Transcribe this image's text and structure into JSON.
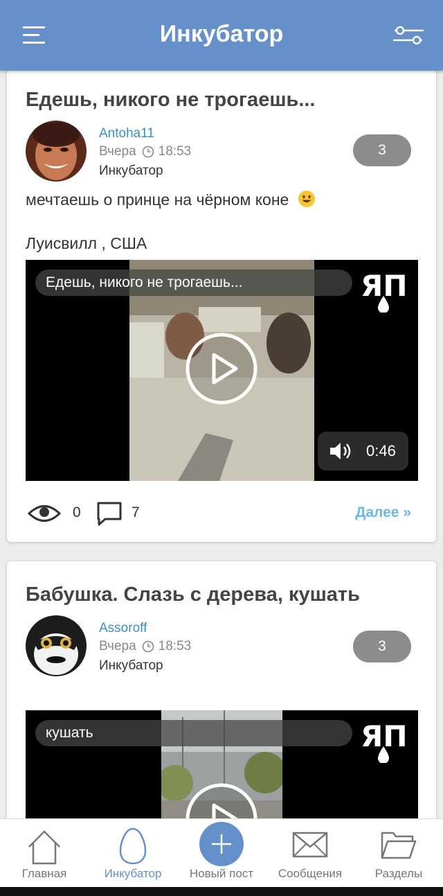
{
  "header": {
    "title": "Инкубатор",
    "menu_icon": "hamburger-menu-icon",
    "filter_icon": "sliders-filter-icon"
  },
  "posts": [
    {
      "title": "Едешь, никого не трогаешь...",
      "author": "Antoha11",
      "date": "Вчера",
      "time": "18:53",
      "section": "Инкубатор",
      "rating": "3",
      "text": "мечтаешь о принце на чёрном коне",
      "location": "Луисвилл , США",
      "video": {
        "title": "Едешь, никого не трогаешь...",
        "duration": "0:46",
        "logo": "ЯП"
      },
      "views": "0",
      "comments": "7",
      "more_label": "Далее »"
    },
    {
      "title": "Бабушка. Слазь с дерева, кушать",
      "author": "Assoroff",
      "date": "Вчера",
      "time": "18:53",
      "section": "Инкубатор",
      "rating": "3",
      "video": {
        "title": "кушать",
        "logo": "ЯП"
      }
    }
  ],
  "nav": [
    {
      "label": "Главная",
      "icon": "home-icon"
    },
    {
      "label": "Инкубатор",
      "icon": "egg-icon",
      "active": true
    },
    {
      "label": "Новый пост",
      "icon": "plus-icon"
    },
    {
      "label": "Сообщения",
      "icon": "envelope-icon"
    },
    {
      "label": "Разделы",
      "icon": "folder-icon"
    }
  ],
  "colors": {
    "accent": "#6590c9",
    "link": "#3d8fc4",
    "more": "#6cb8e6",
    "badge": "#8c8c8c"
  }
}
